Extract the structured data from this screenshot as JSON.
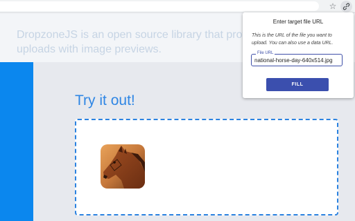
{
  "toolbar": {
    "star_icon": "star-icon",
    "extension_icon": "link-icon"
  },
  "hero": {
    "text_line1": "DropzoneJS is an open source library that provi",
    "text_line2": "uploads with image previews."
  },
  "main": {
    "title": "Try it out!",
    "thumbnail_alt": "horse photo"
  },
  "popup": {
    "title": "Enter target file URL",
    "description": "This is the URL of the file you want to upload. You can also use a data URL.",
    "field_label": "File URL",
    "field_value": "national-horse-day-640x514.jpg",
    "fill_button": "FILL"
  },
  "colors": {
    "accent_blue": "#0b87ee",
    "title_blue": "#2f86e4",
    "popup_button": "#3b4fae",
    "dropzone_border": "#2a82e0"
  }
}
